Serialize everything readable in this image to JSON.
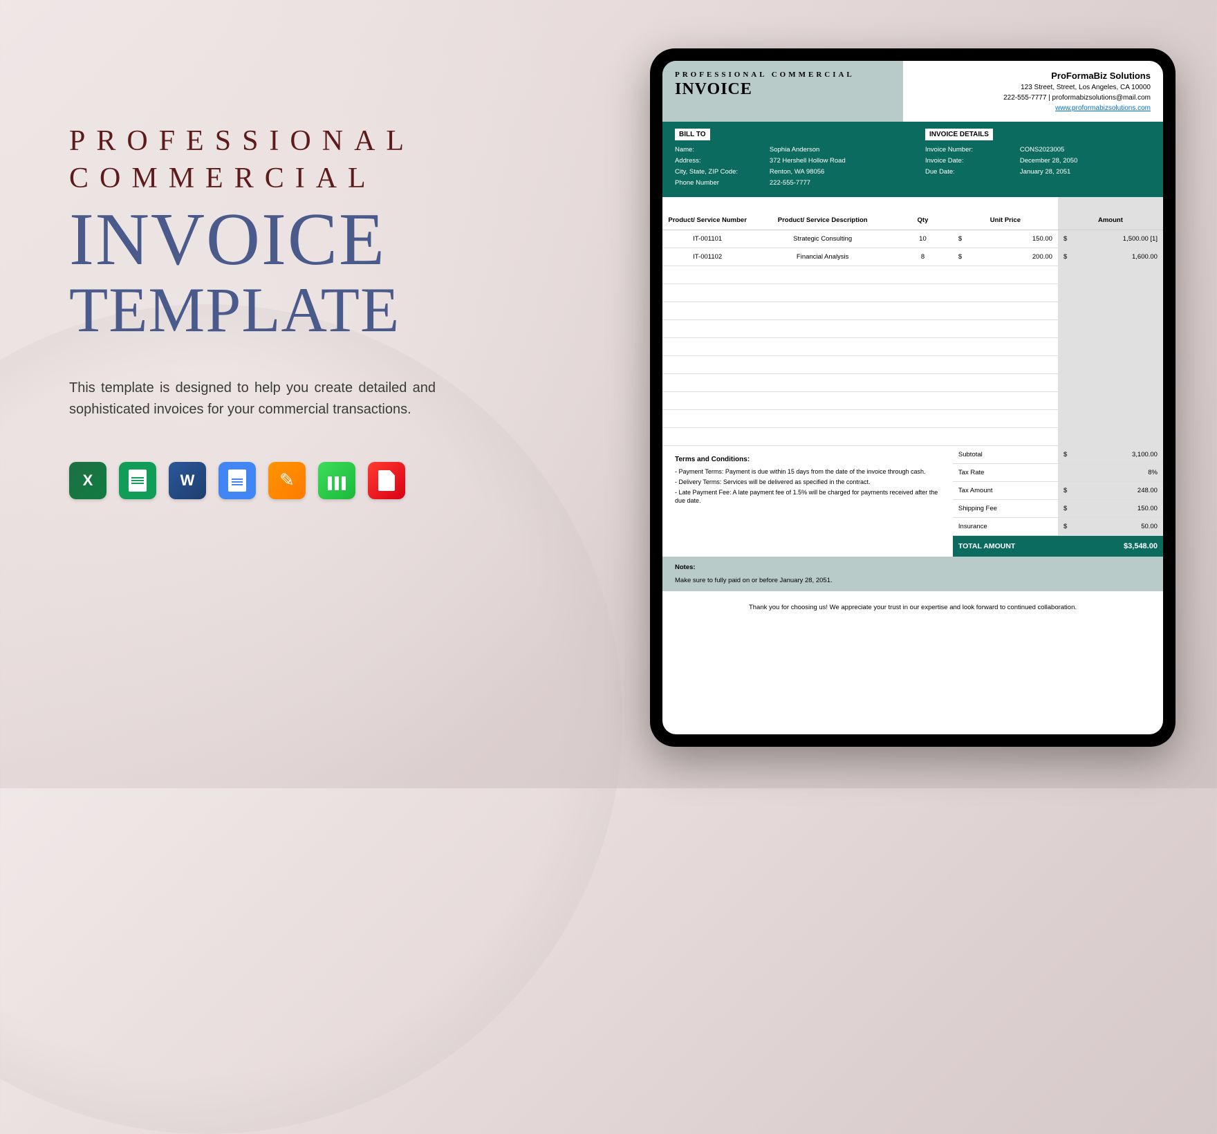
{
  "left": {
    "line1": "PROFESSIONAL",
    "line2": "COMMERCIAL",
    "line3": "INVOICE",
    "line4": "TEMPLATE",
    "desc": "This template is designed to help you create detailed and sophisticated invoices for your commercial transactions.",
    "icons": [
      "excel",
      "sheets",
      "word",
      "docs",
      "pages",
      "numbers",
      "pdf"
    ]
  },
  "invoice": {
    "header": {
      "title1": "PROFESSIONAL COMMERCIAL",
      "title2": "INVOICE",
      "company": "ProFormaBiz Solutions",
      "addr": "123 Street, Street, Los Angeles, CA 10000",
      "phone_email": "222-555-7777  |  proformabizsolutions@mail.com",
      "url": "www.proformabizsolutions.com"
    },
    "billto": {
      "heading": "BILL TO",
      "rows": [
        {
          "l": "Name:",
          "v": "Sophia Anderson"
        },
        {
          "l": "Address:",
          "v": "372 Hershell Hollow Road"
        },
        {
          "l": "City, State, ZIP Code:",
          "v": "Renton, WA 98056"
        },
        {
          "l": "Phone Number",
          "v": "222-555-7777"
        }
      ]
    },
    "details": {
      "heading": "INVOICE DETAILS",
      "rows": [
        {
          "l": "Invoice Number:",
          "v": "CONS2023005"
        },
        {
          "l": "Invoice Date:",
          "v": "December 28, 2050"
        },
        {
          "l": "Due Date:",
          "v": "January 28, 2051"
        }
      ]
    },
    "columns": {
      "c1": "Product/ Service Number",
      "c2": "Product/ Service Description",
      "c3": "Qty",
      "c4": "Unit Price",
      "c5": "Amount"
    },
    "items": [
      {
        "num": "IT-001101",
        "desc": "Strategic Consulting",
        "qty": "10",
        "cur": "$",
        "unit": "150.00",
        "acur": "$",
        "amount": "1,500.00  [1]"
      },
      {
        "num": "IT-001102",
        "desc": "Financial Analysis",
        "qty": "8",
        "cur": "$",
        "unit": "200.00",
        "acur": "$",
        "amount": "1,600.00"
      }
    ],
    "empty_rows": 10,
    "terms": {
      "heading": "Terms and Conditions:",
      "lines": [
        "- Payment Terms: Payment is due within 15 days from the date of the invoice through cash.",
        "- Delivery Terms: Services will be delivered as specified in the contract.",
        "- Late Payment Fee: A late payment fee of 1.5% will be charged for payments received after the due date."
      ]
    },
    "summary": [
      {
        "l": "Subtotal",
        "cur": "$",
        "v": "3,100.00"
      },
      {
        "l": "Tax Rate",
        "cur": "",
        "v": "8%"
      },
      {
        "l": "Tax Amount",
        "cur": "$",
        "v": "248.00"
      },
      {
        "l": "Shipping Fee",
        "cur": "$",
        "v": "150.00"
      },
      {
        "l": "Insurance",
        "cur": "$",
        "v": "50.00"
      }
    ],
    "total": {
      "l": "TOTAL AMOUNT",
      "v": "$3,548.00"
    },
    "notes": {
      "heading": "Notes:",
      "text": "Make sure to fully paid on or before January 28, 2051."
    },
    "thanks": "Thank you for choosing us! We appreciate your trust in our expertise and look forward to continued collaboration."
  }
}
